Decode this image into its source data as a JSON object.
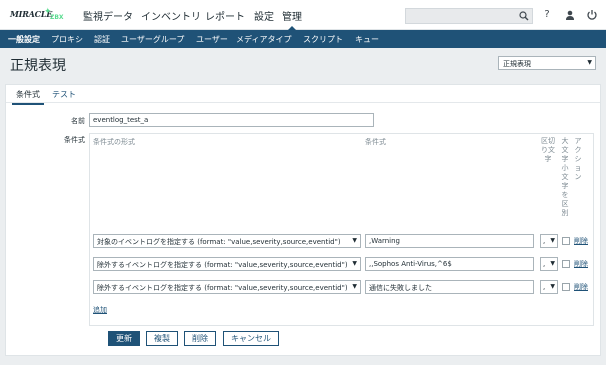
{
  "logo": {
    "text": "MIRACLE",
    "sub": "ZBX"
  },
  "nav": {
    "items": [
      "監視データ",
      "インベントリ",
      "レポート",
      "設定",
      "管理"
    ],
    "active": "管理"
  },
  "topbar": {
    "search_placeholder": "",
    "help_icon": "?"
  },
  "subnav": {
    "items": [
      "一般設定",
      "プロキシ",
      "認証",
      "ユーザーグループ",
      "ユーザー",
      "メディアタイプ",
      "スクリプト",
      "キュー"
    ]
  },
  "page": {
    "title": "正規表現",
    "selector_value": "正規表現"
  },
  "tabs": [
    "条件式",
    "テスト"
  ],
  "form": {
    "name_label": "名前",
    "name_value": "eventlog_test_a",
    "expressions_label": "条件式",
    "headers": {
      "type": "条件式の形式",
      "expression": "条件式",
      "delimiter": "区切り文字",
      "case": "大文字小文字を区別",
      "action": "アクション"
    },
    "rows": [
      {
        "type": "対象のイベントログを指定する (format: \"value,severity,source,eventid\")",
        "expression": ",Warning",
        "delimiter": ",",
        "remove": "削除"
      },
      {
        "type": "除外するイベントログを指定する (format: \"value,severity,source,eventid\")",
        "expression": ",,Sophos Anti-Virus,^6$",
        "delimiter": ",",
        "remove": "削除"
      },
      {
        "type": "除外するイベントログを指定する (format: \"value,severity,source,eventid\")",
        "expression": "通信に失敗しました",
        "delimiter": ",",
        "remove": "削除"
      }
    ],
    "add_link": "追加"
  },
  "buttons": {
    "update": "更新",
    "clone": "複製",
    "delete": "削除",
    "cancel": "キャンセル"
  },
  "colors": {
    "accent": "#1f5277",
    "brand_green": "#59db8f",
    "background": "#ebeef0"
  }
}
